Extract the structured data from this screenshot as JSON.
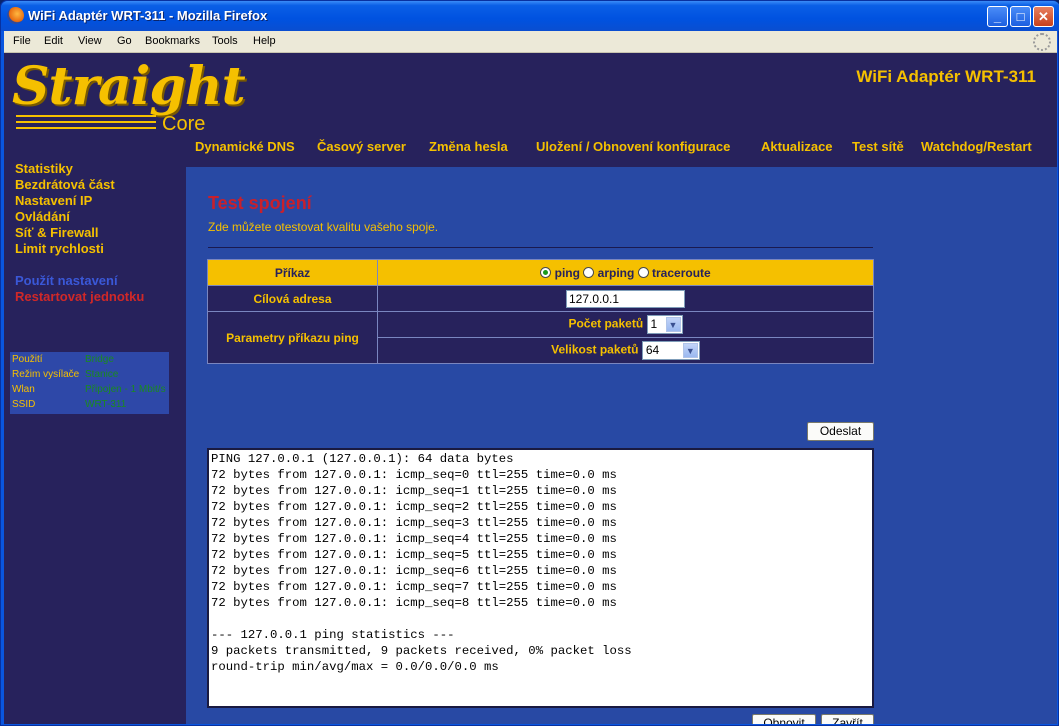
{
  "window": {
    "title": "WiFi Adaptér WRT-311 - Mozilla Firefox",
    "menu": [
      "File",
      "Edit",
      "View",
      "Go",
      "Bookmarks",
      "Tools",
      "Help"
    ]
  },
  "header": {
    "logo_text": "Straight",
    "logo_sub": "Core",
    "device_title": "WiFi Adaptér WRT-311"
  },
  "topnav": [
    "Dynamické DNS",
    "Časový server",
    "Změna hesla",
    "Uložení / Obnovení konfigurace",
    "Aktualizace",
    "Test sítě",
    "Watchdog/Restart"
  ],
  "sidebar": {
    "items": [
      "Statistiky",
      "Bezdrátová část",
      "Nastavení IP",
      "Ovládání",
      "Síť & Firewall",
      "Limit rychlosti"
    ],
    "apply": "Použít nastavení",
    "restart": "Restartovat jednotku",
    "status": [
      {
        "key": "Použití",
        "value": "Bridge"
      },
      {
        "key": "Režim vysílače",
        "value": "Stanice"
      },
      {
        "key": "Wlan",
        "value": "Připojen - 1 Mbit/s"
      },
      {
        "key": "SSID",
        "value": "WRT-311"
      }
    ]
  },
  "main": {
    "title": "Test spojení",
    "subtitle": "Zde můžete otestovat kvalitu vašeho spoje.",
    "form": {
      "command_label": "Příkaz",
      "commands": [
        "ping",
        "arping",
        "traceroute"
      ],
      "selected_command": "ping",
      "target_label": "Cílová adresa",
      "target_value": "127.0.0.1",
      "params_label": "Parametry příkazu ping",
      "count_label": "Počet paketů",
      "count_value": "1",
      "size_label": "Velikost paketů",
      "size_value": "64"
    },
    "send_button": "Odeslat",
    "refresh_button": "Obnovit",
    "close_button": "Zavřít",
    "output": "PING 127.0.0.1 (127.0.0.1): 64 data bytes\n72 bytes from 127.0.0.1: icmp_seq=0 ttl=255 time=0.0 ms\n72 bytes from 127.0.0.1: icmp_seq=1 ttl=255 time=0.0 ms\n72 bytes from 127.0.0.1: icmp_seq=2 ttl=255 time=0.0 ms\n72 bytes from 127.0.0.1: icmp_seq=3 ttl=255 time=0.0 ms\n72 bytes from 127.0.0.1: icmp_seq=4 ttl=255 time=0.0 ms\n72 bytes from 127.0.0.1: icmp_seq=5 ttl=255 time=0.0 ms\n72 bytes from 127.0.0.1: icmp_seq=6 ttl=255 time=0.0 ms\n72 bytes from 127.0.0.1: icmp_seq=7 ttl=255 time=0.0 ms\n72 bytes from 127.0.0.1: icmp_seq=8 ttl=255 time=0.0 ms\n\n--- 127.0.0.1 ping statistics ---\n9 packets transmitted, 9 packets received, 0% packet loss\nround-trip min/avg/max = 0.0/0.0/0.0 ms"
  }
}
